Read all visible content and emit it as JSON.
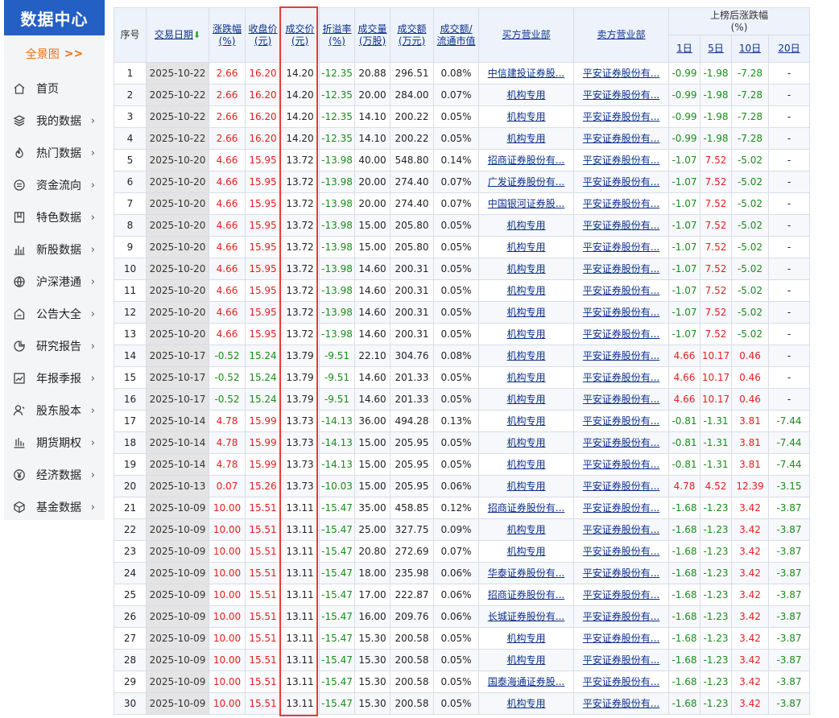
{
  "sidebar": {
    "title": "数据中心",
    "full_map": "全景图",
    "full_map_arrow": ">>",
    "items": [
      {
        "label": "首页",
        "icon": "home-icon",
        "has_arrow": false
      },
      {
        "label": "我的数据",
        "icon": "layers-icon",
        "has_arrow": true
      },
      {
        "label": "热门数据",
        "icon": "fire-icon",
        "has_arrow": true
      },
      {
        "label": "资金流向",
        "icon": "money-flow-icon",
        "has_arrow": true
      },
      {
        "label": "特色数据",
        "icon": "bookmark-icon",
        "has_arrow": true
      },
      {
        "label": "新股数据",
        "icon": "bar-chart-icon",
        "has_arrow": true
      },
      {
        "label": "沪深港通",
        "icon": "globe-icon",
        "has_arrow": true
      },
      {
        "label": "公告大全",
        "icon": "announcement-icon",
        "has_arrow": true
      },
      {
        "label": "研究报告",
        "icon": "pie-chart-icon",
        "has_arrow": true
      },
      {
        "label": "年报季报",
        "icon": "line-chart-icon",
        "has_arrow": true
      },
      {
        "label": "股东股本",
        "icon": "user-icon",
        "has_arrow": true
      },
      {
        "label": "期货期权",
        "icon": "candlestick-icon",
        "has_arrow": true
      },
      {
        "label": "经济数据",
        "icon": "yen-icon",
        "has_arrow": true
      },
      {
        "label": "基金数据",
        "icon": "box-icon",
        "has_arrow": true
      }
    ]
  },
  "table": {
    "headers": {
      "seq": "序号",
      "date": "交易日期",
      "date_sort": "⬇",
      "change_pct": [
        "涨跌幅",
        "(%)"
      ],
      "close": [
        "收盘价",
        "(元)"
      ],
      "price": [
        "成交价",
        "(元)"
      ],
      "discount": [
        "折溢率",
        "(%)"
      ],
      "volume": [
        "成交量",
        "(万股)"
      ],
      "amount": [
        "成交额",
        "(万元)"
      ],
      "ratio": [
        "成交额/",
        "流通市值"
      ],
      "buyer": "买方营业部",
      "seller": "卖方营业部",
      "after_group": [
        "上榜后涨跌幅",
        "(%)"
      ],
      "after": [
        "1日",
        "5日",
        "10日",
        "20日"
      ]
    },
    "rows": [
      [
        "1",
        "2025-10-22",
        "2.66",
        "16.20",
        "14.20",
        "-12.35",
        "20.88",
        "296.51",
        "0.08%",
        "中信建投证券股...",
        "平安证券股份有...",
        "-0.99",
        "-1.98",
        "-7.28",
        "-"
      ],
      [
        "2",
        "2025-10-22",
        "2.66",
        "16.20",
        "14.20",
        "-12.35",
        "20.00",
        "284.00",
        "0.07%",
        "机构专用",
        "平安证券股份有...",
        "-0.99",
        "-1.98",
        "-7.28",
        "-"
      ],
      [
        "3",
        "2025-10-22",
        "2.66",
        "16.20",
        "14.20",
        "-12.35",
        "14.10",
        "200.22",
        "0.05%",
        "机构专用",
        "平安证券股份有...",
        "-0.99",
        "-1.98",
        "-7.28",
        "-"
      ],
      [
        "4",
        "2025-10-22",
        "2.66",
        "16.20",
        "14.20",
        "-12.35",
        "14.10",
        "200.22",
        "0.05%",
        "机构专用",
        "平安证券股份有...",
        "-0.99",
        "-1.98",
        "-7.28",
        "-"
      ],
      [
        "5",
        "2025-10-20",
        "4.66",
        "15.95",
        "13.72",
        "-13.98",
        "40.00",
        "548.80",
        "0.14%",
        "招商证券股份有...",
        "平安证券股份有...",
        "-1.07",
        "7.52",
        "-5.02",
        "-"
      ],
      [
        "6",
        "2025-10-20",
        "4.66",
        "15.95",
        "13.72",
        "-13.98",
        "20.00",
        "274.40",
        "0.07%",
        "广发证券股份有...",
        "平安证券股份有...",
        "-1.07",
        "7.52",
        "-5.02",
        "-"
      ],
      [
        "7",
        "2025-10-20",
        "4.66",
        "15.95",
        "13.72",
        "-13.98",
        "20.00",
        "274.40",
        "0.07%",
        "中国银河证券股...",
        "平安证券股份有...",
        "-1.07",
        "7.52",
        "-5.02",
        "-"
      ],
      [
        "8",
        "2025-10-20",
        "4.66",
        "15.95",
        "13.72",
        "-13.98",
        "15.00",
        "205.80",
        "0.05%",
        "机构专用",
        "平安证券股份有...",
        "-1.07",
        "7.52",
        "-5.02",
        "-"
      ],
      [
        "9",
        "2025-10-20",
        "4.66",
        "15.95",
        "13.72",
        "-13.98",
        "15.00",
        "205.80",
        "0.05%",
        "机构专用",
        "平安证券股份有...",
        "-1.07",
        "7.52",
        "-5.02",
        "-"
      ],
      [
        "10",
        "2025-10-20",
        "4.66",
        "15.95",
        "13.72",
        "-13.98",
        "14.60",
        "200.31",
        "0.05%",
        "机构专用",
        "平安证券股份有...",
        "-1.07",
        "7.52",
        "-5.02",
        "-"
      ],
      [
        "11",
        "2025-10-20",
        "4.66",
        "15.95",
        "13.72",
        "-13.98",
        "14.60",
        "200.31",
        "0.05%",
        "机构专用",
        "平安证券股份有...",
        "-1.07",
        "7.52",
        "-5.02",
        "-"
      ],
      [
        "12",
        "2025-10-20",
        "4.66",
        "15.95",
        "13.72",
        "-13.98",
        "14.60",
        "200.31",
        "0.05%",
        "机构专用",
        "平安证券股份有...",
        "-1.07",
        "7.52",
        "-5.02",
        "-"
      ],
      [
        "13",
        "2025-10-20",
        "4.66",
        "15.95",
        "13.72",
        "-13.98",
        "14.60",
        "200.31",
        "0.05%",
        "机构专用",
        "平安证券股份有...",
        "-1.07",
        "7.52",
        "-5.02",
        "-"
      ],
      [
        "14",
        "2025-10-17",
        "-0.52",
        "15.24",
        "13.79",
        "-9.51",
        "22.10",
        "304.76",
        "0.08%",
        "机构专用",
        "平安证券股份有...",
        "4.66",
        "10.17",
        "0.46",
        "-"
      ],
      [
        "15",
        "2025-10-17",
        "-0.52",
        "15.24",
        "13.79",
        "-9.51",
        "14.60",
        "201.33",
        "0.05%",
        "机构专用",
        "平安证券股份有...",
        "4.66",
        "10.17",
        "0.46",
        "-"
      ],
      [
        "16",
        "2025-10-17",
        "-0.52",
        "15.24",
        "13.79",
        "-9.51",
        "14.60",
        "201.33",
        "0.05%",
        "机构专用",
        "平安证券股份有...",
        "4.66",
        "10.17",
        "0.46",
        "-"
      ],
      [
        "17",
        "2025-10-14",
        "4.78",
        "15.99",
        "13.73",
        "-14.13",
        "36.00",
        "494.28",
        "0.13%",
        "机构专用",
        "平安证券股份有...",
        "-0.81",
        "-1.31",
        "3.81",
        "-7.44"
      ],
      [
        "18",
        "2025-10-14",
        "4.78",
        "15.99",
        "13.73",
        "-14.13",
        "15.00",
        "205.95",
        "0.05%",
        "机构专用",
        "平安证券股份有...",
        "-0.81",
        "-1.31",
        "3.81",
        "-7.44"
      ],
      [
        "19",
        "2025-10-14",
        "4.78",
        "15.99",
        "13.73",
        "-14.13",
        "15.00",
        "205.95",
        "0.05%",
        "机构专用",
        "平安证券股份有...",
        "-0.81",
        "-1.31",
        "3.81",
        "-7.44"
      ],
      [
        "20",
        "2025-10-13",
        "0.07",
        "15.26",
        "13.73",
        "-10.03",
        "15.00",
        "205.95",
        "0.06%",
        "机构专用",
        "平安证券股份有...",
        "4.78",
        "4.52",
        "12.39",
        "-3.15"
      ],
      [
        "21",
        "2025-10-09",
        "10.00",
        "15.51",
        "13.11",
        "-15.47",
        "35.00",
        "458.85",
        "0.12%",
        "招商证券股份有...",
        "平安证券股份有...",
        "-1.68",
        "-1.23",
        "3.42",
        "-3.87"
      ],
      [
        "22",
        "2025-10-09",
        "10.00",
        "15.51",
        "13.11",
        "-15.47",
        "25.00",
        "327.75",
        "0.09%",
        "机构专用",
        "平安证券股份有...",
        "-1.68",
        "-1.23",
        "3.42",
        "-3.87"
      ],
      [
        "23",
        "2025-10-09",
        "10.00",
        "15.51",
        "13.11",
        "-15.47",
        "20.80",
        "272.69",
        "0.07%",
        "机构专用",
        "平安证券股份有...",
        "-1.68",
        "-1.23",
        "3.42",
        "-3.87"
      ],
      [
        "24",
        "2025-10-09",
        "10.00",
        "15.51",
        "13.11",
        "-15.47",
        "18.00",
        "235.98",
        "0.06%",
        "华泰证券股份有...",
        "平安证券股份有...",
        "-1.68",
        "-1.23",
        "3.42",
        "-3.87"
      ],
      [
        "25",
        "2025-10-09",
        "10.00",
        "15.51",
        "13.11",
        "-15.47",
        "17.00",
        "222.87",
        "0.06%",
        "招商证券股份有...",
        "平安证券股份有...",
        "-1.68",
        "-1.23",
        "3.42",
        "-3.87"
      ],
      [
        "26",
        "2025-10-09",
        "10.00",
        "15.51",
        "13.11",
        "-15.47",
        "16.00",
        "209.76",
        "0.06%",
        "长城证券股份有...",
        "平安证券股份有...",
        "-1.68",
        "-1.23",
        "3.42",
        "-3.87"
      ],
      [
        "27",
        "2025-10-09",
        "10.00",
        "15.51",
        "13.11",
        "-15.47",
        "15.30",
        "200.58",
        "0.05%",
        "机构专用",
        "平安证券股份有...",
        "-1.68",
        "-1.23",
        "3.42",
        "-3.87"
      ],
      [
        "28",
        "2025-10-09",
        "10.00",
        "15.51",
        "13.11",
        "-15.47",
        "15.30",
        "200.58",
        "0.05%",
        "机构专用",
        "平安证券股份有...",
        "-1.68",
        "-1.23",
        "3.42",
        "-3.87"
      ],
      [
        "29",
        "2025-10-09",
        "10.00",
        "15.51",
        "13.11",
        "-15.47",
        "15.30",
        "200.58",
        "0.05%",
        "国泰海通证券股...",
        "平安证券股份有...",
        "-1.68",
        "-1.23",
        "3.42",
        "-3.87"
      ],
      [
        "30",
        "2025-10-09",
        "10.00",
        "15.51",
        "13.11",
        "-15.47",
        "15.30",
        "200.58",
        "0.05%",
        "机构专用",
        "平安证券股份有...",
        "-1.68",
        "-1.23",
        "3.42",
        "-3.87"
      ]
    ]
  },
  "colors": {
    "up": "#e41e1e",
    "down": "#1a8b1a",
    "highlight_box": "#e83b3b",
    "brand": "#2460c4"
  }
}
